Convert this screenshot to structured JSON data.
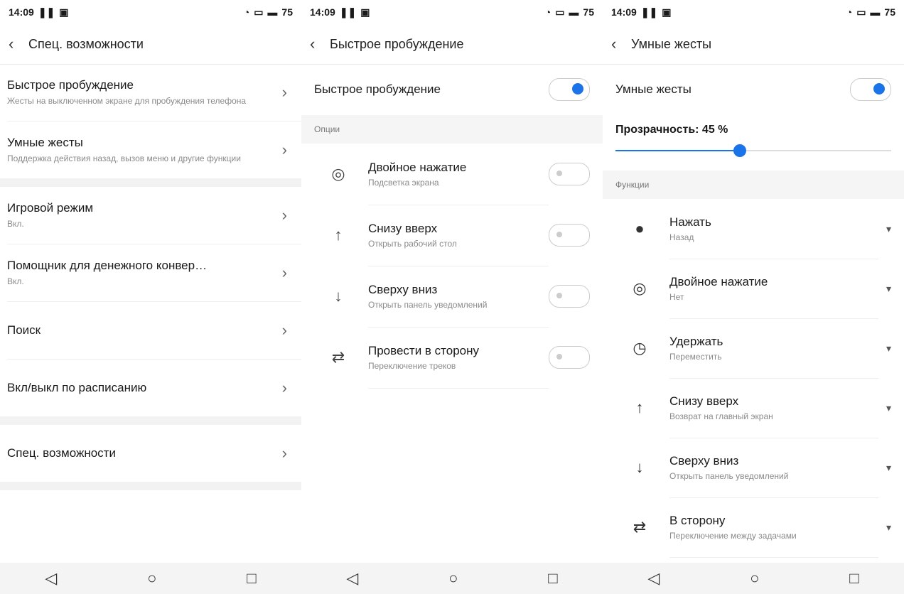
{
  "screen1": {
    "status": {
      "time": "14:09",
      "battery": "75"
    },
    "appbar": {
      "title": "Спец. возможности"
    },
    "items": [
      {
        "title": "Быстрое пробуждение",
        "subtitle": "Жесты на выключенном экране для пробуждения телефона"
      },
      {
        "title": "Умные жесты",
        "subtitle": "Поддержка действия назад, вызов меню и другие функции"
      },
      {
        "title": "Игровой режим",
        "subtitle": "Вкл."
      },
      {
        "title": "Помощник для денежного конвер…",
        "subtitle": "Вкл."
      },
      {
        "title": "Поиск",
        "subtitle": ""
      },
      {
        "title": "Вкл/выкл по расписанию",
        "subtitle": ""
      },
      {
        "title": "Спец. возможности",
        "subtitle": ""
      }
    ]
  },
  "screen2": {
    "status": {
      "time": "14:09",
      "battery": "75"
    },
    "appbar": {
      "title": "Быстрое пробуждение"
    },
    "main_toggle": {
      "label": "Быстрое пробуждение",
      "on": true
    },
    "section_label": "Опции",
    "options": [
      {
        "title": "Двойное нажатие",
        "subtitle": "Подсветка экрана",
        "icon": "double-tap-icon"
      },
      {
        "title": "Снизу вверх",
        "subtitle": "Открыть рабочий стол",
        "icon": "swipe-up-icon"
      },
      {
        "title": "Сверху вниз",
        "subtitle": "Открыть панель уведомлений",
        "icon": "swipe-down-icon"
      },
      {
        "title": "Провести в сторону",
        "subtitle": "Переключение треков",
        "icon": "swipe-side-icon"
      }
    ]
  },
  "screen3": {
    "status": {
      "time": "14:09",
      "battery": "75"
    },
    "appbar": {
      "title": "Умные жесты"
    },
    "main_toggle": {
      "label": "Умные жесты",
      "on": true
    },
    "transparency": {
      "label": "Прозрачность: 45 %",
      "value_percent": 45
    },
    "section_label": "Функции",
    "functions": [
      {
        "title": "Нажать",
        "subtitle": "Назад",
        "icon": "tap-icon"
      },
      {
        "title": "Двойное нажатие",
        "subtitle": "Нет",
        "icon": "double-tap-icon"
      },
      {
        "title": "Удержать",
        "subtitle": "Переместить",
        "icon": "hold-icon"
      },
      {
        "title": "Снизу вверх",
        "subtitle": "Возврат на главный экран",
        "icon": "swipe-up-icon"
      },
      {
        "title": "Сверху вниз",
        "subtitle": "Открыть панель уведомлений",
        "icon": "swipe-down-icon"
      },
      {
        "title": "В сторону",
        "subtitle": "Переключение между задачами",
        "icon": "swipe-side-icon"
      }
    ]
  },
  "colors": {
    "accent": "#1a73e8"
  }
}
